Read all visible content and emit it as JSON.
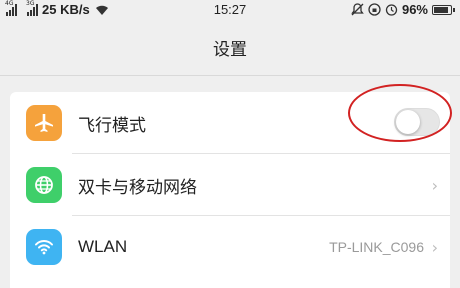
{
  "status_bar": {
    "net1": "4G",
    "net2": "3G",
    "speed": "25 KB/s",
    "time": "15:27",
    "battery": "96%",
    "battery_level": 0.96
  },
  "header": {
    "title": "设置"
  },
  "settings": [
    {
      "label": "飞行模式",
      "icon": "airplane-icon",
      "color": "#f5a23c",
      "control": "toggle",
      "on": false
    },
    {
      "label": "双卡与移动网络",
      "icon": "globe-icon",
      "color": "#3fcf6a",
      "control": "chevron"
    },
    {
      "label": "WLAN",
      "icon": "wifi-icon",
      "color": "#3fb4f2",
      "value": "TP-LINK_C096",
      "control": "chevron"
    }
  ],
  "chevron_glyph": "›",
  "annotation": {
    "color": "#d22222"
  }
}
